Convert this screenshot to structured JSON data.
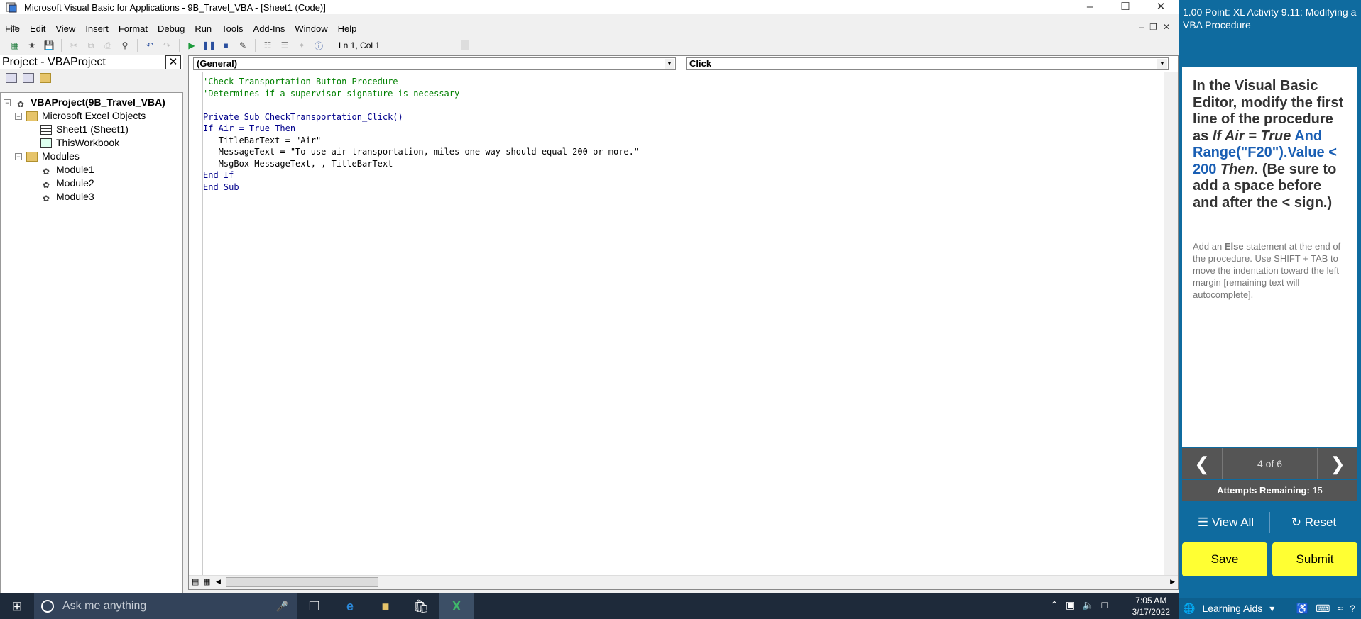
{
  "window": {
    "title": "Microsoft Visual Basic for Applications - 9B_Travel_VBA - [Sheet1 (Code)]"
  },
  "menubar": {
    "items": [
      "File",
      "Edit",
      "View",
      "Insert",
      "Format",
      "Debug",
      "Run",
      "Tools",
      "Add-Ins",
      "Window",
      "Help"
    ]
  },
  "toolbar": {
    "position_text": "Ln 1, Col 1"
  },
  "project": {
    "title": "Project - VBAProject",
    "close_glyph": "✕",
    "root": "VBAProject(9B_Travel_VBA)",
    "excel_objects": "Microsoft Excel Objects",
    "sheet1": "Sheet1 (Sheet1)",
    "workbook": "ThisWorkbook",
    "modules": "Modules",
    "module_items": [
      "Module1",
      "Module2",
      "Module3"
    ]
  },
  "code": {
    "object_combo": "(General)",
    "proc_combo": "Click",
    "lines": [
      "'Check Transportation Button Procedure",
      "'Determines if a supervisor signature is necessary",
      "",
      "Private Sub CheckTransportation_Click()",
      "If Air = True Then",
      "   TitleBarText = \"Air\"",
      "   MessageText = \"To use air transportation, miles one way should equal 200 or more.\"",
      "   MsgBox MessageText, , TitleBarText",
      "End If",
      "End Sub"
    ]
  },
  "taskbar": {
    "search_placeholder": "Ask me anything",
    "time": "7:05 AM",
    "date": "3/17/2022"
  },
  "panel": {
    "title": "1.00 Point: XL Activity 9.11: Modifying a VBA Procedure",
    "instr_pre": "In the Visual Basic Editor, modify the first line of the procedure as ",
    "instr_i1": "If Air = True",
    "instr_blue": " And Range(\"F20\").Value < 200",
    "instr_i2": " Then",
    "instr_post": ". (Be sure to add a space before and after the < sign.)",
    "hint_pre": "Add an ",
    "hint_bold": "Else",
    "hint_post": " statement at the end of the procedure. Use SHIFT + TAB to move the indentation toward the left margin [remaining text will autocomplete].",
    "page_indicator": "4 of 6",
    "attempts_label": "Attempts Remaining:",
    "attempts_value": "15",
    "view_all": "View All",
    "reset": "Reset",
    "save": "Save",
    "submit": "Submit",
    "learning_aids": "Learning Aids"
  }
}
